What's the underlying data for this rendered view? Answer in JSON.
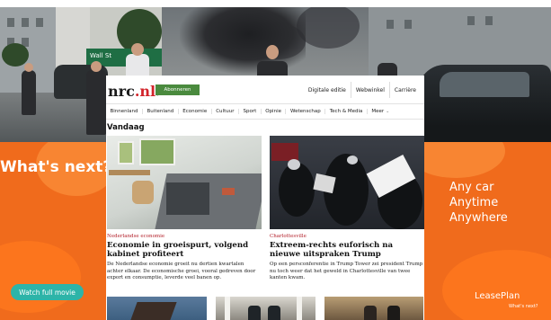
{
  "ad": {
    "left_headline": "What's next?",
    "watch_button": "Watch full movie",
    "tagline": [
      "Any car",
      "Anytime",
      "Anywhere"
    ],
    "brand": "LeasePlan",
    "brand_sub": "What's next?",
    "accent_color": "#f06b1c",
    "button_color": "#2db4a8"
  },
  "site": {
    "logo": "nrc",
    "logo_suffix": ".nl",
    "logo_bracket": ">",
    "subscribe_label": "Abonneren",
    "top_links": [
      "Digitale editie",
      "Webwinkel",
      "Carrière"
    ],
    "nav": [
      "Binnenland",
      "Buitenland",
      "Economie",
      "Cultuur",
      "Sport",
      "Opinie",
      "Wetenschap",
      "Tech & Media",
      "Meer"
    ],
    "section_title": "Vandaag",
    "articles": [
      {
        "kicker": "Nederlandse economie",
        "headline": "Economie in groeispurt, volgend kabinet profiteert",
        "lead": "De Nederlandse economie groeit nu dertien kwartalen achter elkaar. De economische groei, vooral gedreven door export en consumptie, leverde veel banen op."
      },
      {
        "kicker": "Charlottesville",
        "headline": "Extreem-rechts euforisch na nieuwe uitspraken Trump",
        "lead": "Op een persconferentie in Trump Tower zei president Trump nu toch weer dat het geweld in Charlottesville van twee kanten kwam."
      }
    ]
  },
  "scene": {
    "street_sign": "Wall St"
  }
}
